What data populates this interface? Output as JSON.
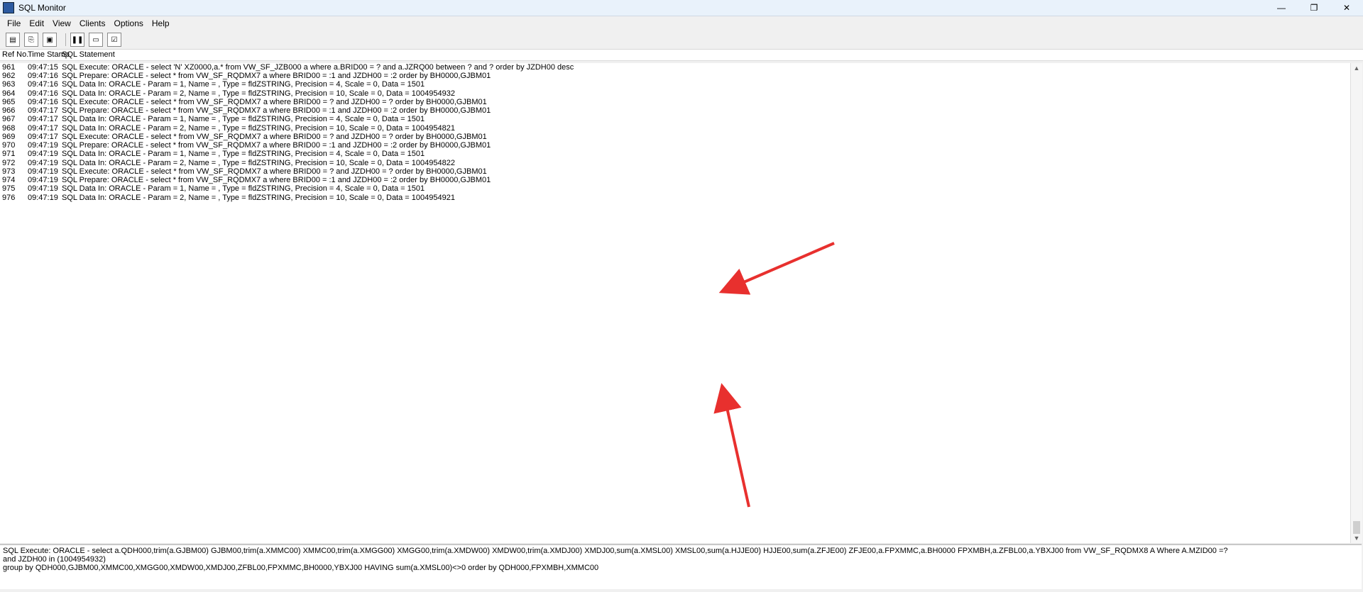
{
  "window": {
    "title": "SQL Monitor",
    "controls": {
      "minimize": "—",
      "maximize": "❐",
      "close": "✕"
    }
  },
  "menu": [
    "File",
    "Edit",
    "View",
    "Clients",
    "Options",
    "Help"
  ],
  "toolbar": {
    "icons": [
      "copy-sheet-icon",
      "copy-icon",
      "image-icon",
      "pause-icon",
      "window-icon",
      "checklist-icon"
    ]
  },
  "headers": {
    "ref": "Ref No.",
    "time": "Time Stamp",
    "stmt": "SQL Statement"
  },
  "log": [
    {
      "ref": "961",
      "time": "09:47:15",
      "stmt": "SQL Execute: ORACLE - select 'N' XZ0000,a.* from VW_SF_JZB000 a where a.BRID00 = ? and a.JZRQ00 between ? and ? order by JZDH00 desc"
    },
    {
      "ref": "962",
      "time": "09:47:16",
      "stmt": "SQL Prepare: ORACLE - select * from VW_SF_RQDMX7 a where BRID00 = :1 and JZDH00 = :2 order by BH0000,GJBM01"
    },
    {
      "ref": "963",
      "time": "09:47:16",
      "stmt": "SQL Data In: ORACLE - Param = 1, Name = , Type = fldZSTRING, Precision = 4, Scale = 0, Data = 1501"
    },
    {
      "ref": "964",
      "time": "09:47:16",
      "stmt": "SQL Data In: ORACLE - Param = 2, Name = , Type = fldZSTRING, Precision = 10, Scale = 0, Data = 1004954932"
    },
    {
      "ref": "965",
      "time": "09:47:16",
      "stmt": "SQL Execute: ORACLE - select * from VW_SF_RQDMX7 a where BRID00 = ? and JZDH00 = ? order by BH0000,GJBM01"
    },
    {
      "ref": "966",
      "time": "09:47:17",
      "stmt": "SQL Prepare: ORACLE - select * from VW_SF_RQDMX7 a where BRID00 = :1 and JZDH00 = :2 order by BH0000,GJBM01"
    },
    {
      "ref": "967",
      "time": "09:47:17",
      "stmt": "SQL Data In: ORACLE - Param = 1, Name = , Type = fldZSTRING, Precision = 4, Scale = 0, Data = 1501"
    },
    {
      "ref": "968",
      "time": "09:47:17",
      "stmt": "SQL Data In: ORACLE - Param = 2, Name = , Type = fldZSTRING, Precision = 10, Scale = 0, Data = 1004954821"
    },
    {
      "ref": "969",
      "time": "09:47:17",
      "stmt": "SQL Execute: ORACLE - select * from VW_SF_RQDMX7 a where BRID00 = ? and JZDH00 = ? order by BH0000,GJBM01"
    },
    {
      "ref": "970",
      "time": "09:47:19",
      "stmt": "SQL Prepare: ORACLE - select * from VW_SF_RQDMX7 a where BRID00 = :1 and JZDH00 = :2 order by BH0000,GJBM01"
    },
    {
      "ref": "971",
      "time": "09:47:19",
      "stmt": "SQL Data In: ORACLE - Param = 1, Name = , Type = fldZSTRING, Precision = 4, Scale = 0, Data = 1501"
    },
    {
      "ref": "972",
      "time": "09:47:19",
      "stmt": "SQL Data In: ORACLE - Param = 2, Name = , Type = fldZSTRING, Precision = 10, Scale = 0, Data = 1004954822"
    },
    {
      "ref": "973",
      "time": "09:47:19",
      "stmt": "SQL Execute: ORACLE - select * from VW_SF_RQDMX7 a where BRID00 = ? and JZDH00 = ? order by BH0000,GJBM01"
    },
    {
      "ref": "974",
      "time": "09:47:19",
      "stmt": "SQL Prepare: ORACLE - select * from VW_SF_RQDMX7 a where BRID00 = :1 and JZDH00 = :2 order by BH0000,GJBM01"
    },
    {
      "ref": "975",
      "time": "09:47:19",
      "stmt": "SQL Data In: ORACLE - Param = 1, Name = , Type = fldZSTRING, Precision = 4, Scale = 0, Data = 1501"
    },
    {
      "ref": "976",
      "time": "09:47:19",
      "stmt": "SQL Data In: ORACLE - Param = 2, Name = , Type = fldZSTRING, Precision = 10, Scale = 0, Data = 1004954921"
    }
  ],
  "selectedRef": "990",
  "detail": [
    "SQL Execute: ORACLE - select a.QDH000,trim(a.GJBM00) GJBM00,trim(a.XMMC00) XMMC00,trim(a.XMGG00) XMGG00,trim(a.XMDW00) XMDW00,trim(a.XMDJ00) XMDJ00,sum(a.XMSL00) XMSL00,sum(a.HJJE00) HJJE00,sum(a.ZFJE00) ZFJE00,a.FPXMMC,a.BH0000 FPXMBH,a.ZFBL00,a.YBXJ00 from VW_SF_RQDMX8 A Where A.MZID00 =?",
    " and JZDH00 in (1004954932)",
    " group by QDH000,GJBM00,XMMC00,XMGG00,XMDW00,XMDJ00,ZFBL00,FPXMMC,BH0000,YBXJ00 HAVING sum(a.XMSL00)<>0 order by QDH000,FPXMBH,XMMC00"
  ]
}
